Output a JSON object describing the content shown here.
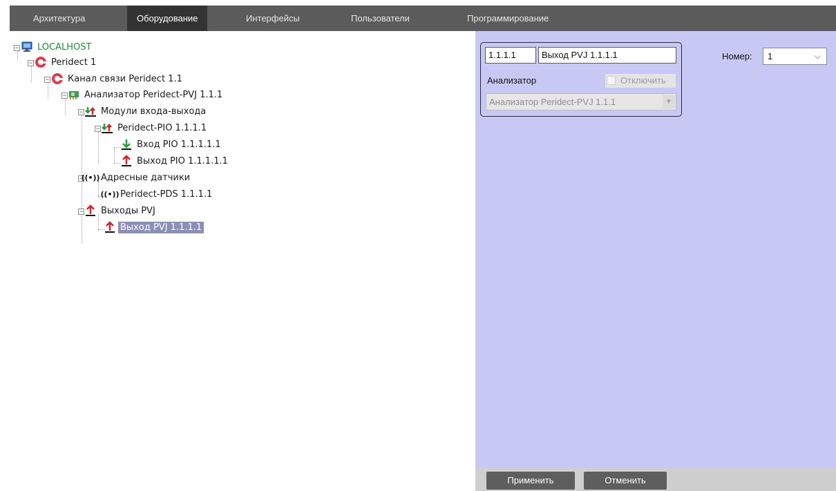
{
  "tabs": [
    {
      "label": "Архитектура",
      "active": false
    },
    {
      "label": "Оборудование",
      "active": true
    },
    {
      "label": "Интерфейсы",
      "active": false
    },
    {
      "label": "Пользователи",
      "active": false
    },
    {
      "label": "Программирование",
      "active": false
    }
  ],
  "tree": {
    "root": "LOCALHOST",
    "peridect": "Peridect 1",
    "channel": "Канал связи Peridect 1.1",
    "analyzer": "Анализатор Peridect-PVJ 1.1.1",
    "io_modules": "Модули входа-выхода",
    "pio": "Peridect-PIO 1.1.1.1",
    "pio_input": "Вход PIO 1.1.1.1.1",
    "pio_output": "Выход PIO 1.1.1.1.1",
    "address_sensors": "Адресные датчики",
    "pds": "Peridect-PDS 1.1.1.1",
    "pvj_outputs": "Выходы PVJ",
    "pvj_output": "Выход PVJ 1.1.1.1"
  },
  "settings": {
    "id_value": "1.1.1.1",
    "name_value": "Выход PVJ 1.1.1.1",
    "analyzer_label": "Анализатор",
    "disable_label": "Отключить",
    "analyzer_value": "Анализатор Peridect-PVJ 1.1.1",
    "number_label": "Номер:",
    "number_value": "1",
    "apply_label": "Применить",
    "cancel_label": "Отменить"
  },
  "colors": {
    "tabbar": "#5b5b5b",
    "active_tab": "#333333",
    "panel": "#c8c8f4",
    "selection": "#8c8fb9",
    "root_text": "#1f8a3b"
  }
}
